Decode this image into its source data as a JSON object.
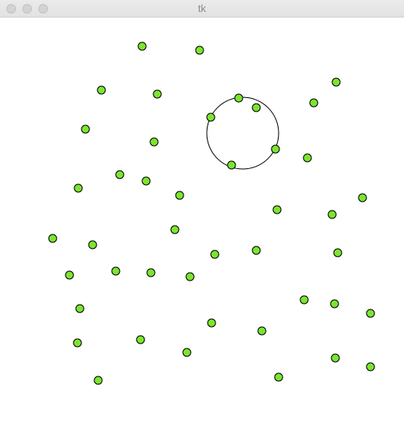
{
  "window": {
    "title": "tk",
    "controls": {
      "close": "close-button",
      "minimize": "minimize-button",
      "zoom": "zoom-button"
    }
  },
  "canvas": {
    "dot_fill": "#7be52f",
    "dot_stroke": "#000000",
    "selection_circle_stroke": "#000000"
  }
}
